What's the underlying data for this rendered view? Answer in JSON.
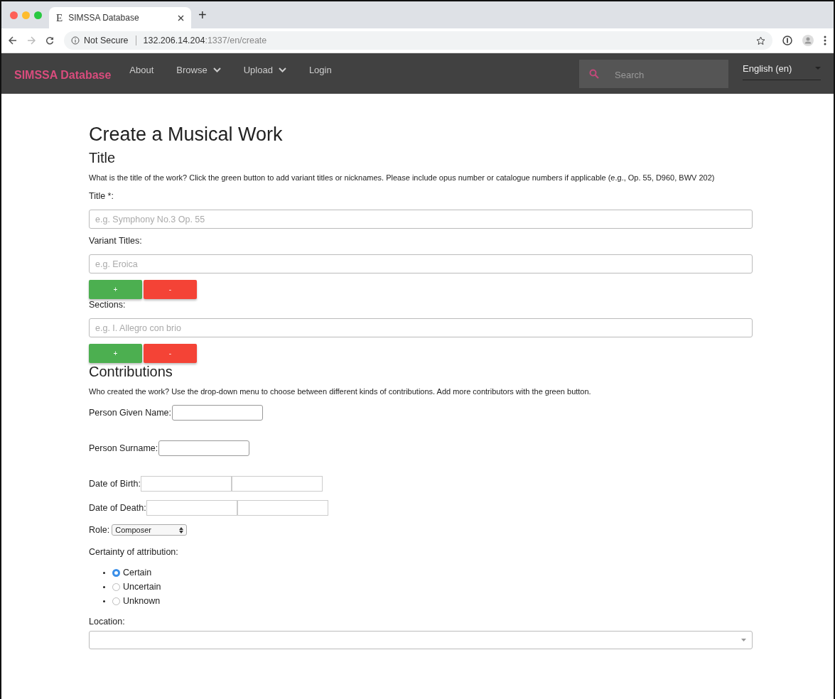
{
  "browser": {
    "tab_title": "SIMSSA Database",
    "tab_favicon": "E",
    "new_tab": "+",
    "security": "Not Secure",
    "url_host": "132.206.14.204",
    "url_rest": ":1337/en/create"
  },
  "navbar": {
    "brand": "SIMSSA Database",
    "items": [
      {
        "label": "About",
        "dropdown": false
      },
      {
        "label": "Browse",
        "dropdown": true
      },
      {
        "label": "Upload",
        "dropdown": true
      },
      {
        "label": "Login",
        "dropdown": false
      }
    ],
    "search": {
      "placeholder": "Search"
    },
    "language": "English (en)"
  },
  "page": {
    "heading": "Create a Musical Work",
    "sections": [
      {
        "kind": "heading",
        "text": "Title"
      },
      {
        "kind": "help",
        "text": "What is the title of the work? Click the green button to add variant titles or nicknames. Please include opus number or catalogue numbers if applicable (e.g., Op. 55, D960, BWV 202)"
      },
      {
        "kind": "wide_field",
        "label": "Title *:",
        "placeholder": "e.g. Symphony No.3 Op. 55"
      },
      {
        "kind": "wide_field",
        "label": "Variant Titles:",
        "placeholder": "e.g. Eroica"
      },
      {
        "kind": "buttons",
        "add": "+",
        "remove": "-"
      },
      {
        "kind": "wide_field",
        "label": "Sections:",
        "placeholder": "e.g. I. Allegro con brio"
      },
      {
        "kind": "buttons",
        "add": "+",
        "remove": "-"
      },
      {
        "kind": "heading",
        "text": "Contributions"
      },
      {
        "kind": "help",
        "text": "Who created the work? Use the drop-down menu to choose between different kinds of contributions. Add more contributors with the green button."
      },
      {
        "kind": "inline_field",
        "label": "Person Given Name:"
      },
      {
        "kind": "inline_field",
        "label": "Person Surname:"
      },
      {
        "kind": "date_field",
        "label": "Date of Birth:"
      },
      {
        "kind": "date_field",
        "label": "Date of Death:"
      },
      {
        "kind": "select",
        "label": "Role:",
        "value": "Composer"
      },
      {
        "kind": "radios",
        "label": "Certainty of attribution:",
        "options": [
          {
            "label": "Certain",
            "selected": true
          },
          {
            "label": "Uncertain",
            "selected": false
          },
          {
            "label": "Unknown",
            "selected": false
          }
        ]
      },
      {
        "kind": "combo",
        "label": "Location:"
      }
    ]
  }
}
